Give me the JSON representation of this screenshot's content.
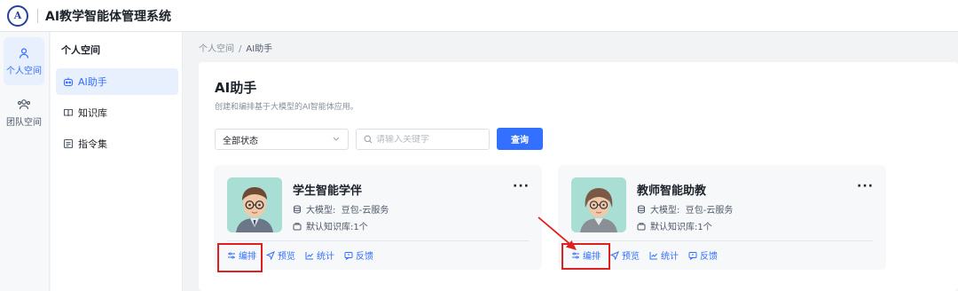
{
  "header": {
    "logo_text": "A",
    "title": "AI教学智能体管理系统"
  },
  "rail": [
    {
      "label": "个人空间",
      "icon": "user-icon",
      "active": true
    },
    {
      "label": "团队空间",
      "icon": "team-icon",
      "active": false
    }
  ],
  "subnav": {
    "title": "个人空间",
    "items": [
      {
        "label": "AI助手",
        "icon": "robot-icon",
        "active": true
      },
      {
        "label": "知识库",
        "icon": "book-icon",
        "active": false
      },
      {
        "label": "指令集",
        "icon": "list-icon",
        "active": false
      }
    ]
  },
  "breadcrumb": {
    "root": "个人空间",
    "separator": "/",
    "current": "AI助手"
  },
  "page": {
    "title": "AI助手",
    "description": "创建和编排基于大模型的AI智能体应用。"
  },
  "filters": {
    "status_value": "全部状态",
    "search_placeholder": "请输入关键字",
    "search_button": "查询"
  },
  "cards": [
    {
      "name": "学生智能学伴",
      "model_label": "大模型:",
      "model_value": "豆包-云服务",
      "kb_label": "默认知识库:",
      "kb_value": "1个",
      "more": "···",
      "actions": [
        "编排",
        "预览",
        "统计",
        "反馈"
      ]
    },
    {
      "name": "教师智能助教",
      "model_label": "大模型:",
      "model_value": "豆包-云服务",
      "kb_label": "默认知识库:",
      "kb_value": "1个",
      "more": "···",
      "actions": [
        "编排",
        "预览",
        "统计",
        "反馈"
      ]
    }
  ],
  "colors": {
    "primary": "#3370ff",
    "highlight": "#e02020"
  }
}
